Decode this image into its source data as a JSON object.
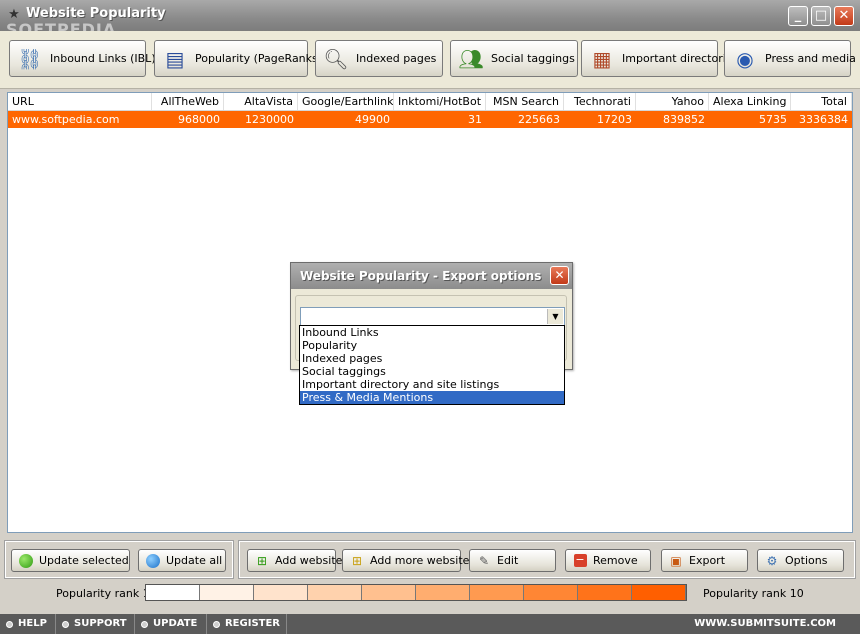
{
  "window": {
    "title": "Website Popularity",
    "watermark": "SOFTPEDIA"
  },
  "toolbar": {
    "buttons": [
      {
        "label": "Inbound Links (IBL)",
        "icon": "links-icon"
      },
      {
        "label": "Popularity (PageRanks)",
        "icon": "popularity-icon"
      },
      {
        "label": "Indexed pages",
        "icon": "magnifier-icon"
      },
      {
        "label": "Social taggings",
        "icon": "people-icon"
      },
      {
        "label": "Important directories",
        "icon": "directory-icon"
      },
      {
        "label": "Press and media",
        "icon": "press-icon"
      }
    ]
  },
  "table": {
    "columns": [
      "URL",
      "AllTheWeb",
      "AltaVista",
      "Google/Earthlink",
      "Inktomi/HotBot",
      "MSN Search",
      "Technorati",
      "Yahoo",
      "Alexa Linking",
      "Total"
    ],
    "rows": [
      [
        "www.softpedia.com",
        "968000",
        "1230000",
        "49900",
        "31",
        "225663",
        "17203",
        "839852",
        "5735",
        "3336384"
      ]
    ]
  },
  "dialog": {
    "title": "Website Popularity - Export options",
    "close": "✕",
    "options": [
      "Inbound Links",
      "Popularity",
      "Indexed pages",
      "Social taggings",
      "Important directory and site listings",
      "Press & Media Mentions"
    ],
    "highlighted_index": 5
  },
  "actions": {
    "update_selected": "Update selected",
    "update_all": "Update all",
    "add_website": "Add website",
    "add_more": "Add more websites",
    "edit": "Edit",
    "remove": "Remove",
    "export": "Export",
    "options": "Options"
  },
  "rank": {
    "min_label": "Popularity rank 1",
    "max_label": "Popularity rank 10",
    "colors": [
      "#ffffff",
      "#fff2e6",
      "#ffe3cc",
      "#ffd2ad",
      "#ffc08f",
      "#ffad6f",
      "#ff9a50",
      "#ff8634",
      "#ff731a",
      "#ff5f00"
    ]
  },
  "status": {
    "items": [
      "HELP",
      "SUPPORT",
      "UPDATE",
      "REGISTER"
    ],
    "url": "WWW.SUBMITSUITE.COM"
  },
  "colors": {
    "selected_row": "#ff6600",
    "highlight": "#316ac5"
  }
}
